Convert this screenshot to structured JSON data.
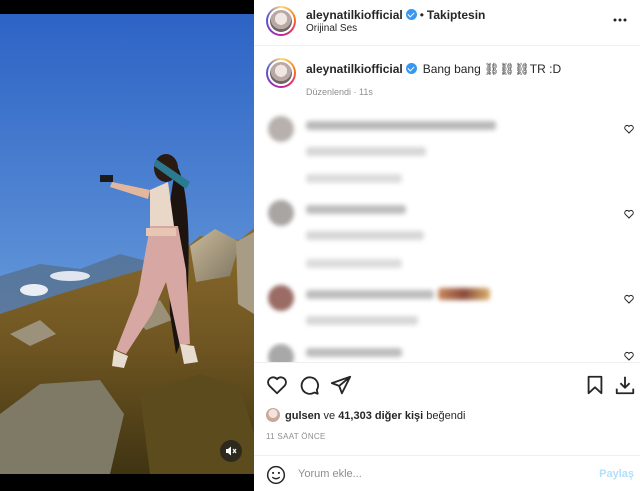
{
  "post": {
    "username": "aleynatilkiofficial",
    "follow_state": "Takiptesin",
    "audio": "Orijinal Ses",
    "caption_text": "Bang bang ⛓⛓⛓TR :D",
    "edited_label": "Düzenlendi · 11s"
  },
  "engagement": {
    "liker": "gulsen",
    "likes_middle": " ve ",
    "likes_count": "41,303 diğer kişi",
    "likes_suffix": " beğendi",
    "timestamp": "11 SAAT ÖNCE"
  },
  "comment_box": {
    "placeholder": "Yorum ekle...",
    "post_label": "Paylaş"
  },
  "icons": {
    "more": "more-options-icon",
    "like": "heart-icon",
    "comment": "comment-bubble-icon",
    "share": "paper-plane-icon",
    "save": "bookmark-icon",
    "download": "download-icon",
    "mute": "speaker-muted-icon",
    "emoji": "smiley-icon"
  },
  "colors": {
    "verified": "#3897f0",
    "post_button_disabled": "#b2dffc",
    "secondary_text": "#8e8e8e"
  }
}
